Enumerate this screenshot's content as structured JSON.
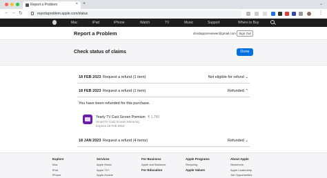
{
  "browser": {
    "tab_title": "Report a Problem",
    "tab_close": "×",
    "new_tab": "+",
    "tab_menu": "⌄",
    "back": "←",
    "forward": "→",
    "reload": "↻",
    "url": "reportaproblem.apple.com/status"
  },
  "global_nav": {
    "items": [
      "Mac",
      "iPad",
      "iPhone",
      "Watch",
      "TV",
      "Music",
      "Support",
      "Where to Buy"
    ]
  },
  "header": {
    "title": "Report a Problem",
    "email": "droidappsreviewer@gmail.com",
    "sign_out": "Sign Out"
  },
  "claims": {
    "title": "Check status of claims",
    "done": "Done"
  },
  "rows": [
    {
      "date": "18 FEB 2023",
      "desc": "Request a refund (1 item)",
      "status": "Not eligible for refund ⌄"
    },
    {
      "date": "18 FEB 2023",
      "desc": "Request a refund (1 item)",
      "status": "Refunded ⌃"
    },
    {
      "date": "18 JAN 2023",
      "desc": "Request a refund (4 items)",
      "status": "Refunded ⌄"
    }
  ],
  "refund_detail": {
    "message": "You have been refunded for this purchase.",
    "app_name": "Yearly TV Cast Screen Premium",
    "price": "₹ 1,799",
    "developer": "SmartTV Cast Screen Mirroring",
    "expires": "Expires 18 Feb 2023"
  },
  "footer": {
    "columns": [
      {
        "heading": "Explore",
        "items": [
          "Mac",
          "iPad",
          "iPhone"
        ]
      },
      {
        "heading": "Services",
        "items": [
          "Apple Music",
          "Apple TV+",
          "Apple Arcade"
        ]
      },
      {
        "heading": "For Business",
        "items": [
          "Apple and Business",
          ""
        ],
        "heading2": "For Education"
      },
      {
        "heading": "Apple Programs",
        "items": [
          "Recycling",
          ""
        ],
        "heading2": "Apple Values"
      },
      {
        "heading": "About Apple",
        "items": [
          "Newsroom",
          "Apple Leadership",
          "Job Opportunities"
        ]
      }
    ]
  }
}
